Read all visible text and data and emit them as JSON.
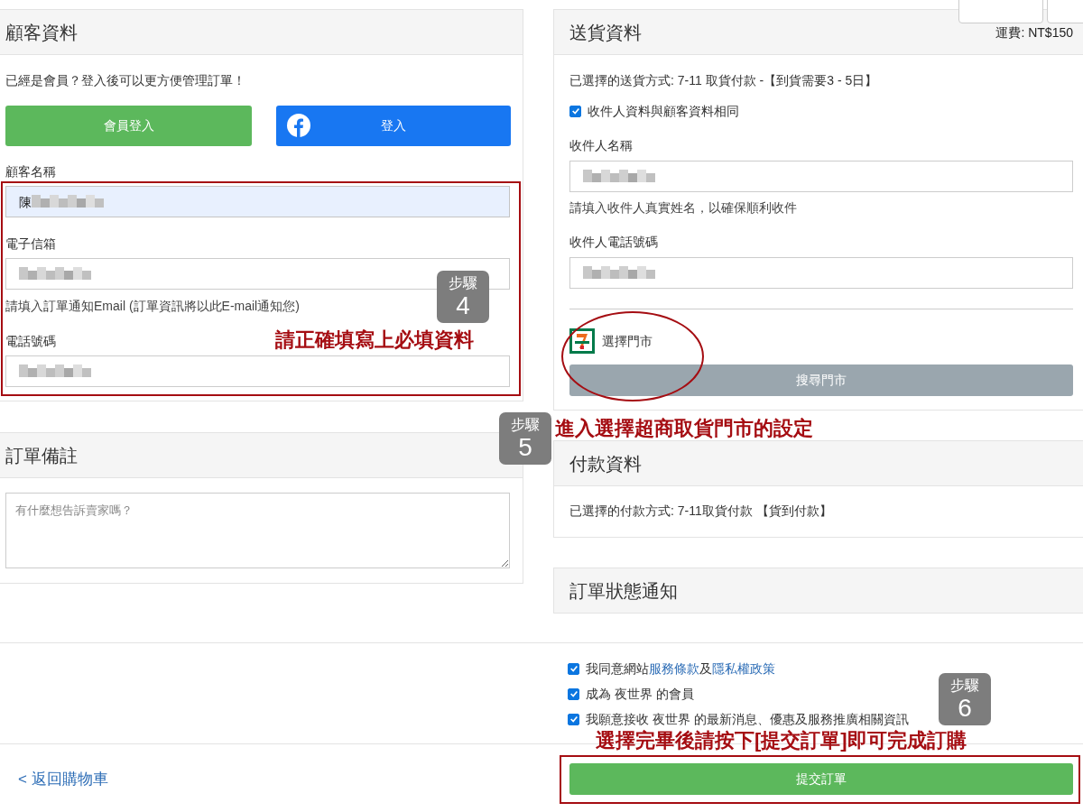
{
  "customer": {
    "title": "顧客資料",
    "prompt": "已經是會員？登入後可以更方便管理訂單！",
    "buttons": [
      {
        "kind": "member",
        "label": "會員登入"
      },
      {
        "kind": "facebook",
        "label": "登入"
      }
    ],
    "fields": [
      {
        "label": "顧客名稱",
        "value": "陳",
        "redacted": true,
        "autofilled": true
      },
      {
        "label": "電子信箱",
        "redacted": true,
        "autofilled": false,
        "help": "請填入訂單通知Email (訂單資訊將以此E-mail通知您)"
      },
      {
        "label": "電話號碼",
        "redacted": true,
        "autofilled": false
      }
    ]
  },
  "note": {
    "title": "訂單備註",
    "placeholder": "有什麼想告訴賣家嗎？"
  },
  "header_buttons": [
    {
      "kind": "cut"
    },
    {
      "kind": "cut"
    }
  ],
  "shipping": {
    "title": "送貨資料",
    "fee": "運費: NT$150",
    "method": "已選擇的送貨方式: 7-11 取貨付款 -【到貨需要3 - 5日】",
    "same_as_customer": {
      "label": "收件人資料與顧客資料相同",
      "checked": true
    },
    "fields": [
      {
        "label": "收件人名稱",
        "redacted": true,
        "help": "請填入收件人真實姓名，以確保順利收件"
      },
      {
        "label": "收件人電話號碼",
        "redacted": true
      }
    ],
    "store_label": "選擇門市",
    "store_button": "搜尋門市"
  },
  "payment": {
    "title": "付款資料",
    "method": "已選擇的付款方式: 7-11取貨付款 【貨到付款】"
  },
  "status": {
    "title": "訂單狀態通知"
  },
  "agreements": [
    {
      "checked": true,
      "parts": [
        {
          "text": "我同意網站",
          "link": false
        },
        {
          "text": "服務條款",
          "link": true
        },
        {
          "text": "及",
          "link": false
        },
        {
          "text": "隱私權政策",
          "link": true
        }
      ]
    },
    {
      "checked": true,
      "parts": [
        {
          "text": "成為 夜世界 的會員",
          "link": false
        }
      ]
    },
    {
      "checked": true,
      "parts": [
        {
          "text": "我願意接收 夜世界 的最新消息、優惠及服務推廣相關資訊",
          "link": false
        }
      ]
    }
  ],
  "back_link": "< 返回購物車",
  "submit": "提交訂單",
  "annotations": [
    {
      "kind": "frame"
    },
    {
      "kind": "step",
      "label": "步驟",
      "number": "4"
    },
    {
      "kind": "note",
      "text": "請正確填寫上必填資料"
    },
    {
      "kind": "ellipse"
    },
    {
      "kind": "step",
      "label": "步驟",
      "number": "5"
    },
    {
      "kind": "note",
      "text": "進入選擇超商取貨門市的設定"
    },
    {
      "kind": "step",
      "label": "步驟",
      "number": "6"
    },
    {
      "kind": "note",
      "text": "選擇完畢後請按下[提交訂單]即可完成訂購"
    },
    {
      "kind": "frame"
    }
  ]
}
